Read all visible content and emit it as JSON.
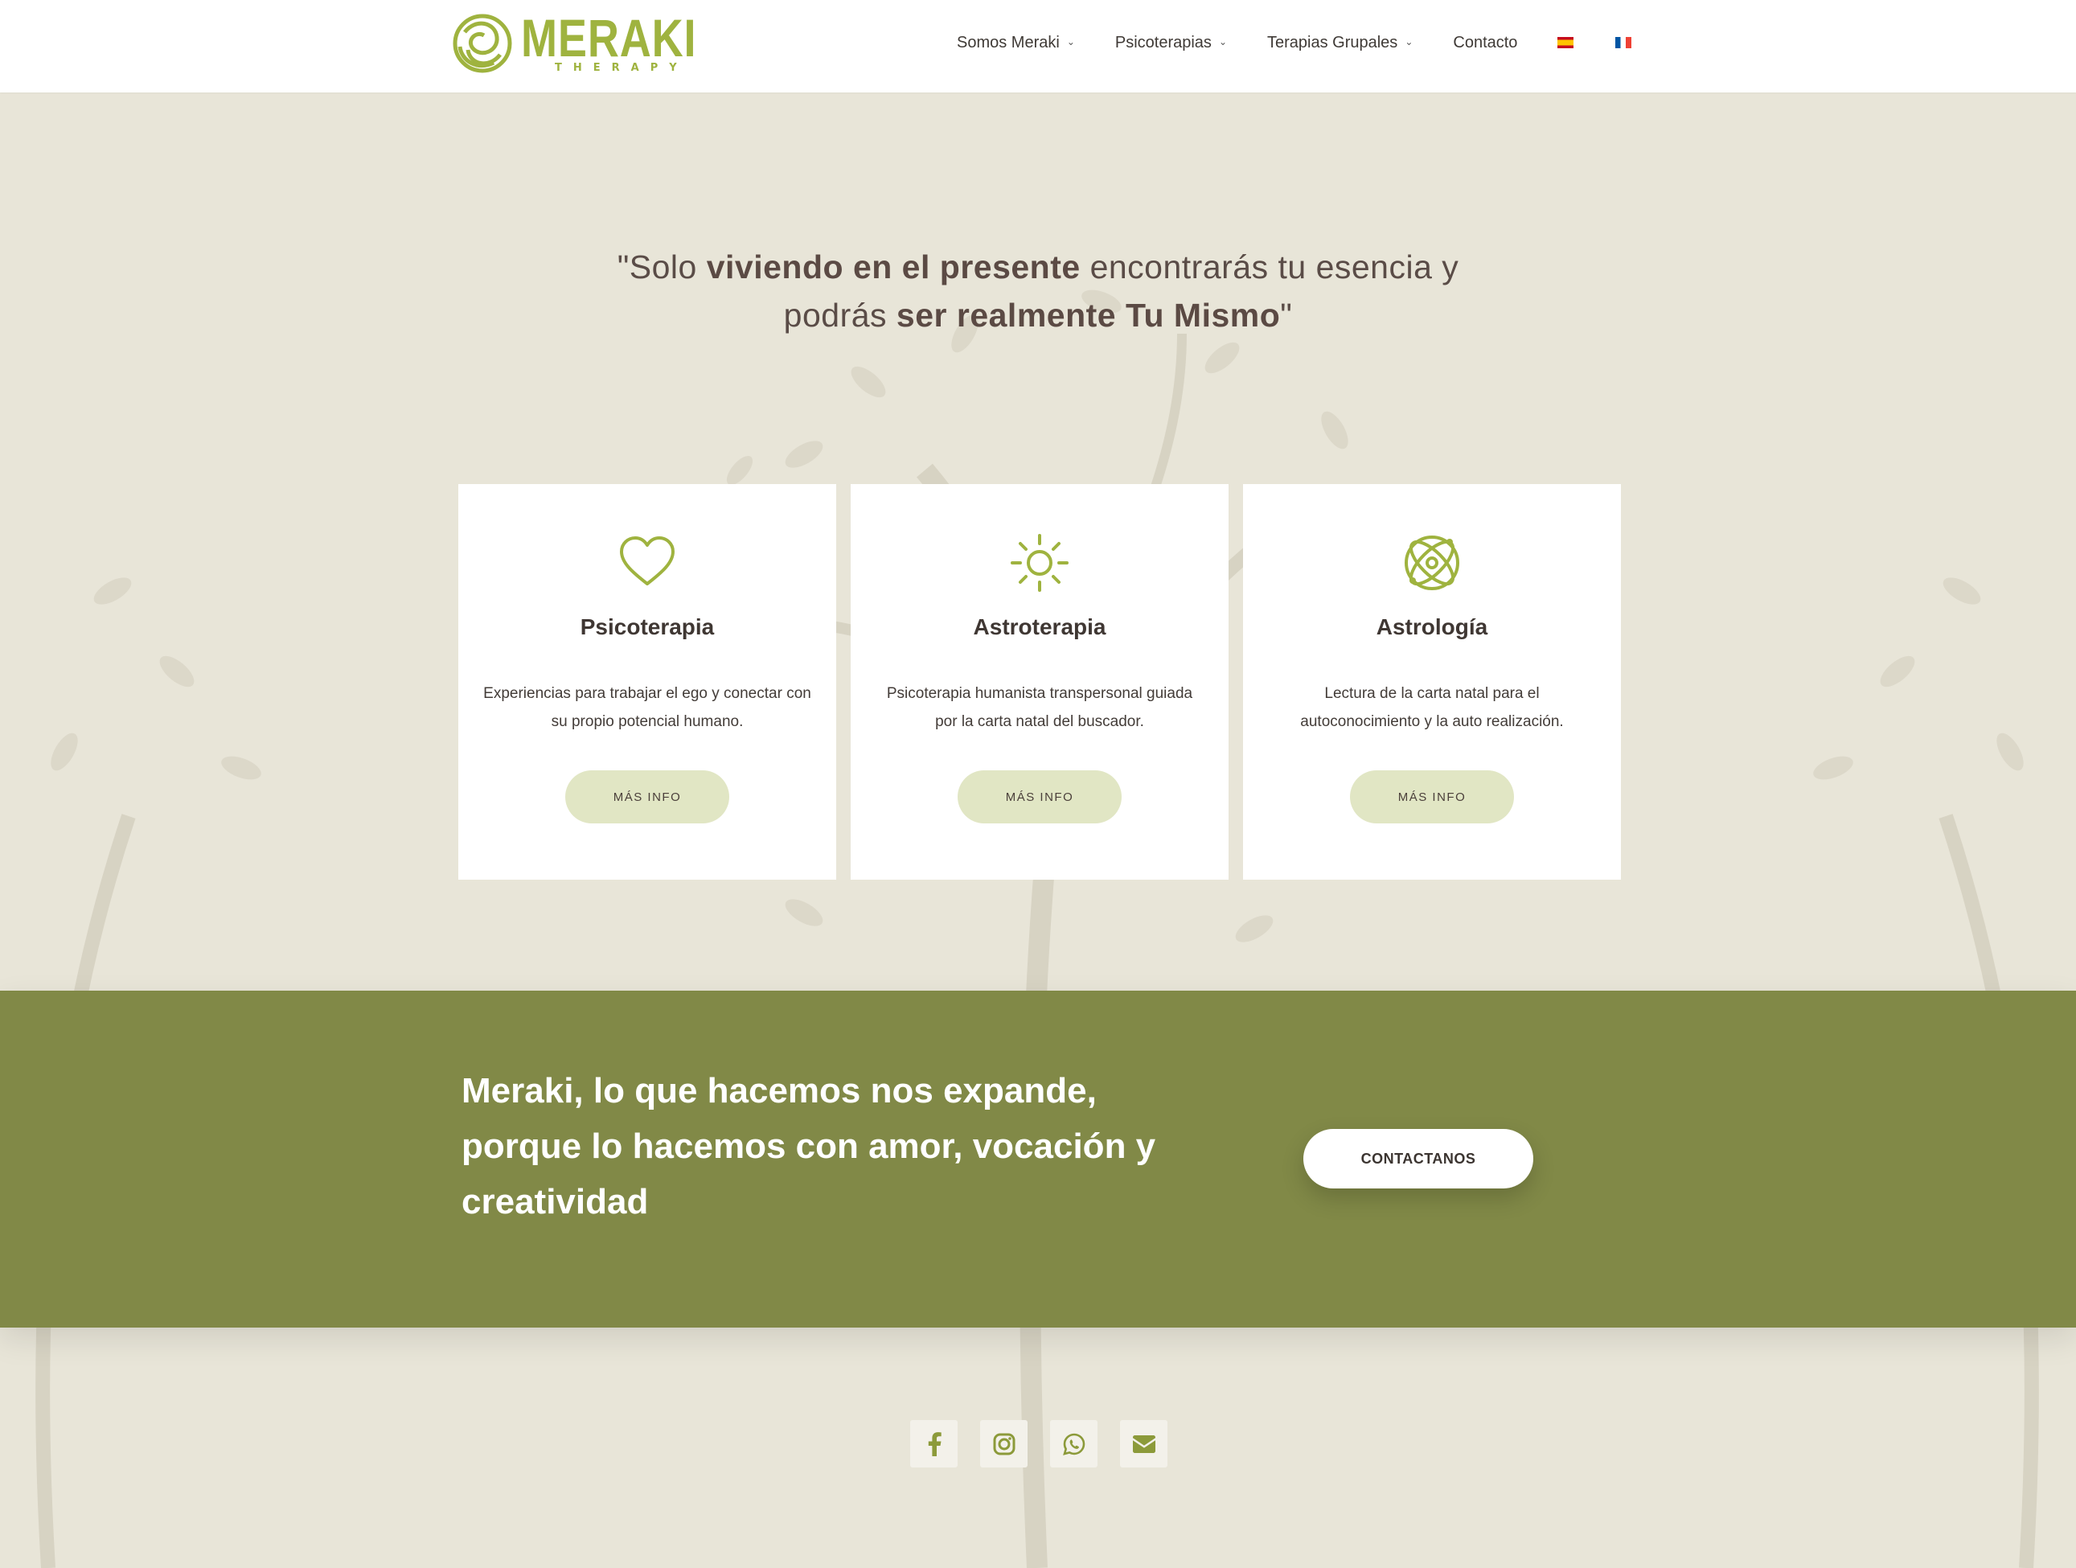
{
  "brand": {
    "name": "MERAKI",
    "subtitle": "THERAPY",
    "accent": "#9fb33f",
    "band_color": "#818947"
  },
  "nav": {
    "items": [
      {
        "label": "Somos Meraki",
        "dropdown": true
      },
      {
        "label": "Psicoterapias",
        "dropdown": true
      },
      {
        "label": "Terapias Grupales",
        "dropdown": true
      },
      {
        "label": "Contacto",
        "dropdown": false
      }
    ],
    "languages": [
      {
        "icon": "flag-es-icon"
      },
      {
        "icon": "flag-fr-icon"
      }
    ]
  },
  "quote": {
    "p1": "\"Solo ",
    "b1": "viviendo en el presente",
    "p2": " encontrarás tu esencia y podrás ",
    "b2": "ser realmente Tu Mismo",
    "p3": "\""
  },
  "cards": [
    {
      "icon": "heart-icon",
      "title": "Psicoterapia",
      "text": "Experiencias para trabajar el ego y conectar con su propio potencial humano.",
      "button": "MÁS INFO"
    },
    {
      "icon": "sun-icon",
      "title": "Astroterapia",
      "text": "Psicoterapia humanista transpersonal guiada por la carta natal del buscador.",
      "button": "MÁS INFO"
    },
    {
      "icon": "atom-icon",
      "title": "Astrología",
      "text": "Lectura de la carta natal para el autoconocimiento y la auto realización.",
      "button": "MÁS INFO"
    }
  ],
  "band": {
    "text": "Meraki, lo que hacemos nos expande, porque lo hacemos con amor, vocación y creatividad",
    "button": "CONTACTANOS"
  },
  "socials": [
    "facebook-icon",
    "instagram-icon",
    "whatsapp-icon",
    "envelope-icon"
  ]
}
